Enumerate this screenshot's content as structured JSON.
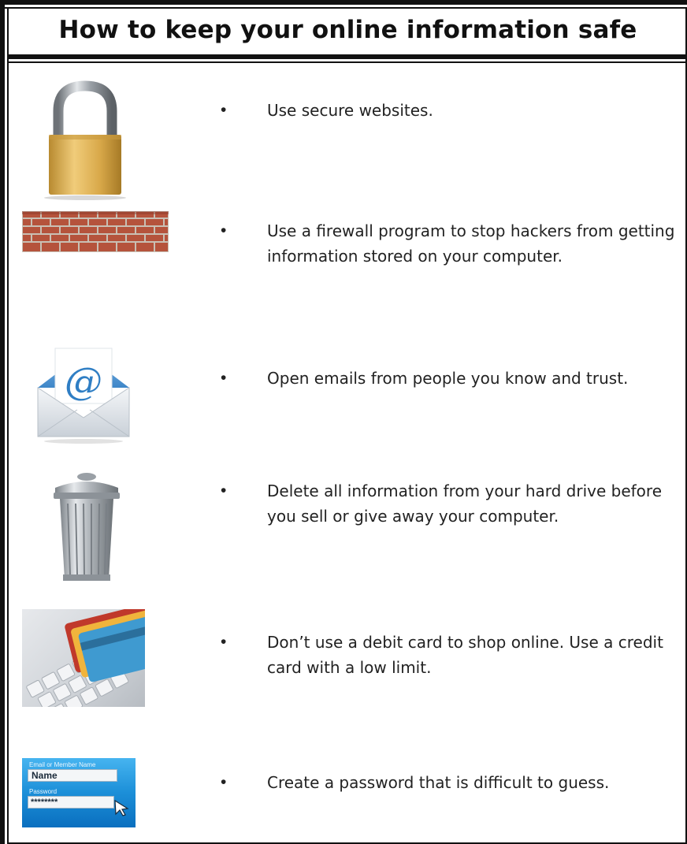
{
  "title": "How to keep your online information safe",
  "bullet_glyph": "•",
  "items": [
    {
      "icon": "padlock-icon",
      "text": "Use secure websites."
    },
    {
      "icon": "brick-wall-icon",
      "text": "Use a firewall program to stop hackers from getting information stored on your computer."
    },
    {
      "icon": "email-envelope-icon",
      "text": "Open emails from people you know and trust."
    },
    {
      "icon": "trash-can-icon",
      "text": "Delete all information from your hard drive before you sell or give away your computer."
    },
    {
      "icon": "credit-cards-keyboard-icon",
      "text": "Don’t use a debit card to shop online. Use a credit card with a low limit."
    },
    {
      "icon": "login-form-icon",
      "text": "Create a password that is difficult to guess."
    }
  ],
  "login_image": {
    "label_user": "Email or Member Name",
    "value_user": "Name",
    "label_password": "Password",
    "value_password": "********"
  },
  "email_image": {
    "at_sign": "@"
  },
  "colors": {
    "frame": "#111111",
    "text": "#222222",
    "lock_body": "#d9a94a",
    "brick": "#b5533c",
    "login_blue": "#1c8fd8"
  }
}
